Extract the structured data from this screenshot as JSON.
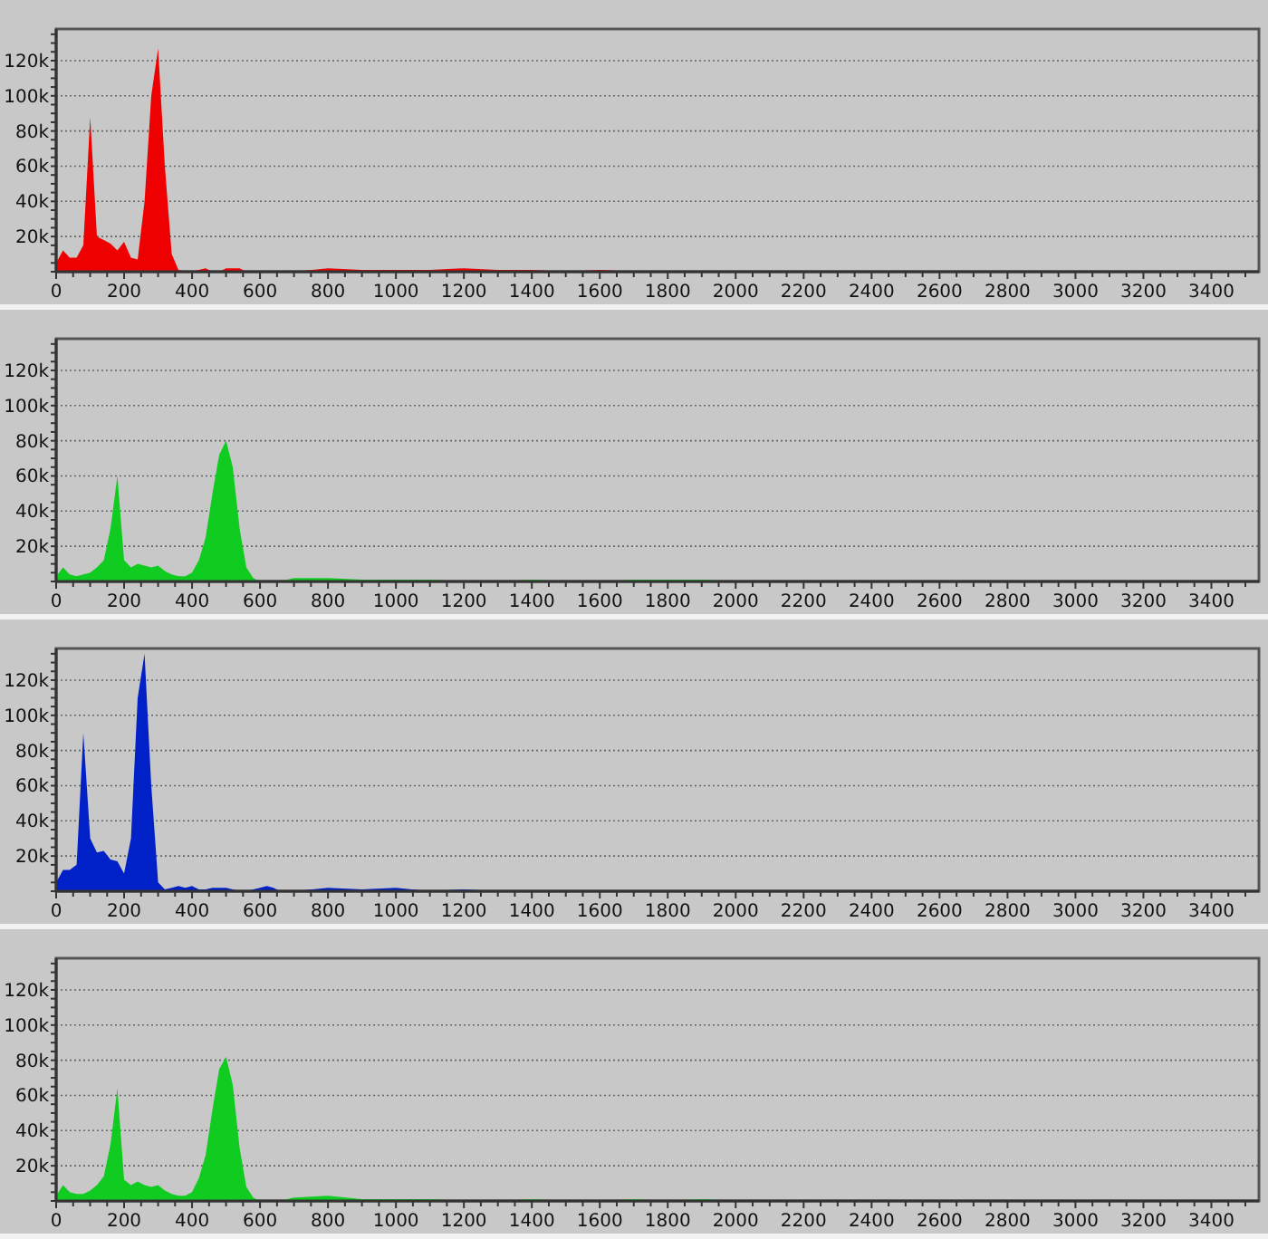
{
  "panels": [
    {
      "chart_data": {
        "type": "area",
        "grid": true,
        "xlim": [
          0,
          3540
        ],
        "ylim": [
          0,
          138000
        ],
        "xticks": [
          0,
          200,
          400,
          600,
          800,
          1000,
          1200,
          1400,
          1600,
          1800,
          2000,
          2200,
          2400,
          2600,
          2800,
          3000,
          3200,
          3400
        ],
        "yticks": [
          {
            "value": 20000,
            "label": "20k"
          },
          {
            "value": 40000,
            "label": "40k"
          },
          {
            "value": 60000,
            "label": "60k"
          },
          {
            "value": 80000,
            "label": "80k"
          },
          {
            "value": 100000,
            "label": "100k"
          },
          {
            "value": 120000,
            "label": "120k"
          }
        ],
        "x": [
          0,
          20,
          40,
          60,
          80,
          100,
          120,
          140,
          160,
          180,
          200,
          220,
          240,
          260,
          280,
          300,
          320,
          340,
          360,
          380,
          400,
          420,
          440,
          460,
          480,
          500,
          520,
          540,
          560,
          580,
          600,
          620,
          640,
          660,
          680,
          700,
          800,
          900,
          1000,
          1100,
          1200,
          1300,
          1400,
          1500,
          1600,
          1700,
          1800,
          1900,
          2000,
          2100,
          2200,
          2300,
          2400,
          2500,
          2600,
          2700,
          2800,
          2900,
          3000,
          3100,
          3200,
          3300,
          3400,
          3500
        ],
        "series": [
          {
            "color": "#ee0000",
            "values": [
              5000,
              12000,
              8000,
              8000,
              15000,
              88000,
              20000,
              18000,
              16000,
              12000,
              17000,
              8000,
              7000,
              40000,
              100000,
              127000,
              60000,
              10000,
              1000,
              0,
              0,
              1000,
              2000,
              0,
              0,
              2000,
              2000,
              2000,
              0,
              0,
              0,
              0,
              0,
              0,
              0,
              0,
              2000,
              1000,
              1000,
              1000,
              2000,
              1000,
              1000,
              0,
              1000,
              0,
              0,
              0,
              0,
              0,
              0,
              0,
              0,
              0,
              0,
              0,
              0,
              0,
              0,
              0,
              0,
              0,
              0,
              0
            ]
          }
        ]
      }
    },
    {
      "chart_data": {
        "type": "area",
        "grid": true,
        "xlim": [
          0,
          3540
        ],
        "ylim": [
          0,
          138000
        ],
        "xticks": [
          0,
          200,
          400,
          600,
          800,
          1000,
          1200,
          1400,
          1600,
          1800,
          2000,
          2200,
          2400,
          2600,
          2800,
          3000,
          3200,
          3400
        ],
        "yticks": [
          {
            "value": 20000,
            "label": "20k"
          },
          {
            "value": 40000,
            "label": "40k"
          },
          {
            "value": 60000,
            "label": "60k"
          },
          {
            "value": 80000,
            "label": "80k"
          },
          {
            "value": 100000,
            "label": "100k"
          },
          {
            "value": 120000,
            "label": "120k"
          }
        ],
        "x": [
          0,
          20,
          40,
          60,
          80,
          100,
          120,
          140,
          160,
          180,
          200,
          220,
          240,
          260,
          280,
          300,
          320,
          340,
          360,
          380,
          400,
          420,
          440,
          460,
          480,
          500,
          520,
          540,
          560,
          580,
          600,
          620,
          640,
          660,
          680,
          700,
          800,
          900,
          1000,
          1100,
          1200,
          1300,
          1400,
          1500,
          1600,
          1700,
          1800,
          1900,
          2000,
          2100,
          2200,
          2300,
          2400,
          2500,
          2600,
          2700,
          2800,
          2900,
          3000,
          3100,
          3200,
          3300,
          3400,
          3500
        ],
        "series": [
          {
            "color": "#10cc20",
            "values": [
              3000,
              8000,
              4000,
              3000,
              4000,
              5000,
              8000,
              12000,
              30000,
              60000,
              12000,
              8000,
              10000,
              9000,
              8000,
              9000,
              6000,
              4000,
              3000,
              3000,
              5000,
              12000,
              25000,
              50000,
              72000,
              80000,
              65000,
              30000,
              8000,
              2000,
              0,
              0,
              0,
              0,
              1000,
              2000,
              2000,
              1000,
              1000,
              1000,
              0,
              0,
              1000,
              0,
              0,
              1000,
              1000,
              1000,
              0,
              0,
              0,
              0,
              0,
              0,
              0,
              0,
              0,
              0,
              0,
              0,
              0,
              0,
              0,
              0
            ]
          }
        ]
      }
    },
    {
      "chart_data": {
        "type": "area",
        "grid": true,
        "xlim": [
          0,
          3540
        ],
        "ylim": [
          0,
          138000
        ],
        "xticks": [
          0,
          200,
          400,
          600,
          800,
          1000,
          1200,
          1400,
          1600,
          1800,
          2000,
          2200,
          2400,
          2600,
          2800,
          3000,
          3200,
          3400
        ],
        "yticks": [
          {
            "value": 20000,
            "label": "20k"
          },
          {
            "value": 40000,
            "label": "40k"
          },
          {
            "value": 60000,
            "label": "60k"
          },
          {
            "value": 80000,
            "label": "80k"
          },
          {
            "value": 100000,
            "label": "100k"
          },
          {
            "value": 120000,
            "label": "120k"
          }
        ],
        "x": [
          0,
          20,
          40,
          60,
          80,
          100,
          120,
          140,
          160,
          180,
          200,
          220,
          240,
          260,
          280,
          300,
          320,
          340,
          360,
          380,
          400,
          420,
          440,
          460,
          480,
          500,
          520,
          540,
          560,
          580,
          600,
          620,
          640,
          660,
          680,
          700,
          800,
          900,
          1000,
          1100,
          1200,
          1300,
          1400,
          1500,
          1600,
          1700,
          1800,
          1900,
          2000,
          2100,
          2200,
          2300,
          2400,
          2500,
          2600,
          2700,
          2800,
          2900,
          3000,
          3100,
          3200,
          3300,
          3400,
          3500
        ],
        "series": [
          {
            "color": "#0020c8",
            "values": [
              5000,
              12000,
              12000,
              15000,
              90000,
              30000,
              22000,
              23000,
              18000,
              17000,
              10000,
              30000,
              110000,
              135000,
              60000,
              5000,
              1000,
              2000,
              3000,
              2000,
              3000,
              1000,
              1000,
              2000,
              2000,
              2000,
              1000,
              0,
              0,
              1000,
              2000,
              3000,
              2000,
              0,
              0,
              0,
              2000,
              1000,
              2000,
              0,
              1000,
              0,
              0,
              0,
              0,
              0,
              0,
              0,
              0,
              0,
              0,
              0,
              0,
              0,
              0,
              0,
              0,
              0,
              0,
              0,
              0,
              0,
              0,
              0
            ]
          }
        ]
      }
    },
    {
      "chart_data": {
        "type": "area",
        "grid": true,
        "xlim": [
          0,
          3540
        ],
        "ylim": [
          0,
          138000
        ],
        "xticks": [
          0,
          200,
          400,
          600,
          800,
          1000,
          1200,
          1400,
          1600,
          1800,
          2000,
          2200,
          2400,
          2600,
          2800,
          3000,
          3200,
          3400
        ],
        "yticks": [
          {
            "value": 20000,
            "label": "20k"
          },
          {
            "value": 40000,
            "label": "40k"
          },
          {
            "value": 60000,
            "label": "60k"
          },
          {
            "value": 80000,
            "label": "80k"
          },
          {
            "value": 100000,
            "label": "100k"
          },
          {
            "value": 120000,
            "label": "120k"
          }
        ],
        "x": [
          0,
          20,
          40,
          60,
          80,
          100,
          120,
          140,
          160,
          180,
          200,
          220,
          240,
          260,
          280,
          300,
          320,
          340,
          360,
          380,
          400,
          420,
          440,
          460,
          480,
          500,
          520,
          540,
          560,
          580,
          600,
          620,
          640,
          660,
          680,
          700,
          800,
          900,
          1000,
          1100,
          1200,
          1300,
          1400,
          1500,
          1600,
          1700,
          1800,
          1900,
          2000,
          2100,
          2200,
          2300,
          2400,
          2500,
          2600,
          2700,
          2800,
          2900,
          3000,
          3100,
          3200,
          3300,
          3400,
          3500
        ],
        "series": [
          {
            "color": "#10cc20",
            "values": [
              3000,
              9000,
              5000,
              4000,
              4000,
              6000,
              9000,
              14000,
              32000,
              64000,
              12000,
              9000,
              11000,
              9000,
              8000,
              9000,
              6000,
              4000,
              3000,
              3000,
              5000,
              13000,
              26000,
              52000,
              75000,
              82000,
              66000,
              30000,
              8000,
              2000,
              0,
              0,
              0,
              0,
              1000,
              2000,
              3000,
              1000,
              1000,
              1000,
              0,
              0,
              1000,
              0,
              0,
              1000,
              0,
              1000,
              0,
              0,
              0,
              0,
              0,
              0,
              0,
              0,
              0,
              0,
              0,
              0,
              0,
              0,
              0,
              0
            ]
          }
        ]
      }
    }
  ]
}
